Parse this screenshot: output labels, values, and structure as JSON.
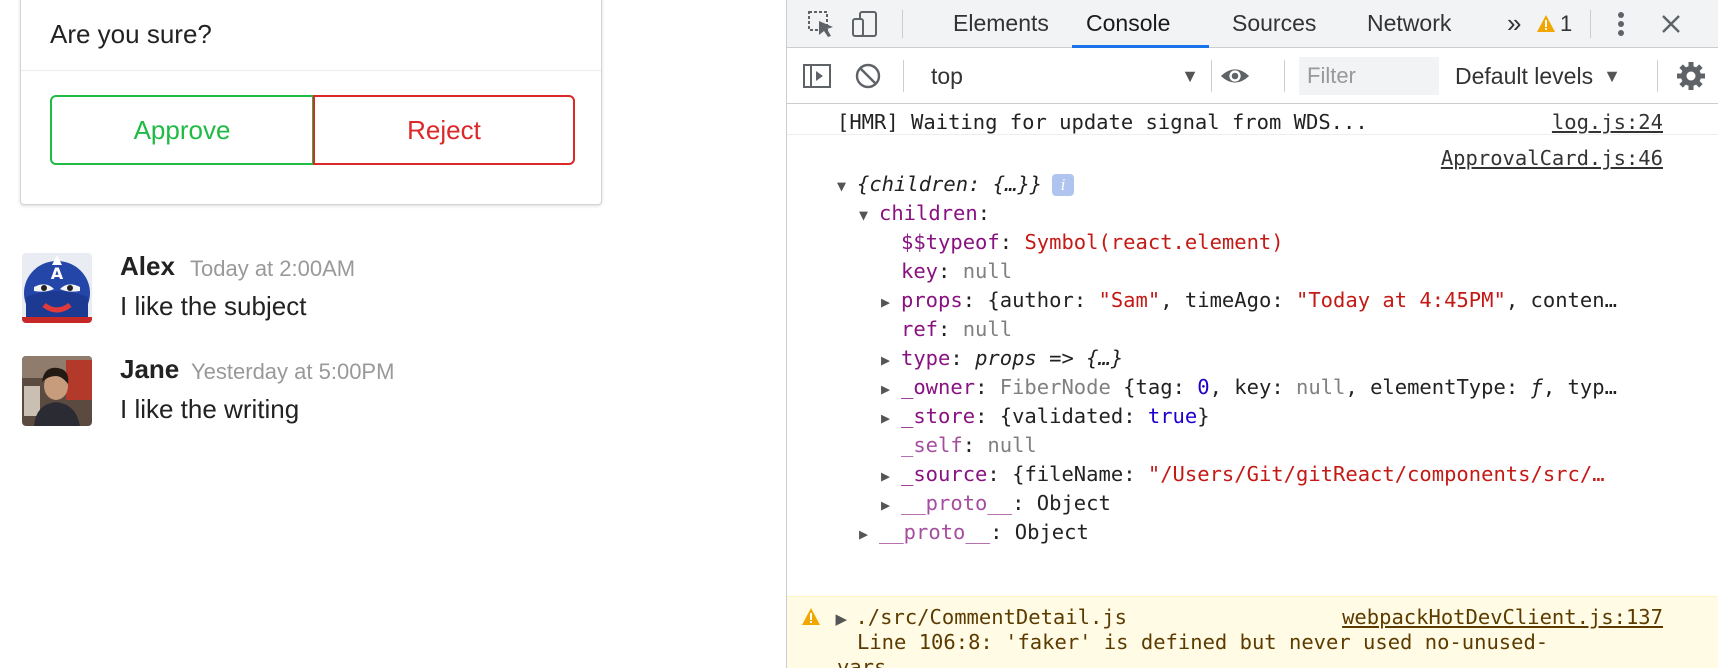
{
  "approval_card": {
    "question": "Are you sure?",
    "approve_label": "Approve",
    "reject_label": "Reject",
    "approve_color": "#21ba45",
    "reject_color": "#db2828"
  },
  "comments": [
    {
      "author": "Alex",
      "time": "Today at 2:00AM",
      "text": "I like the subject",
      "avatar": "captain-america-avatar"
    },
    {
      "author": "Jane",
      "time": "Yesterday at 5:00PM",
      "text": "I like the writing",
      "avatar": "person-photo-avatar"
    }
  ],
  "devtools": {
    "tabs": [
      "Elements",
      "Console",
      "Sources",
      "Network"
    ],
    "active_tab": "Console",
    "more_tabs_icon": "chevron-double-right-icon",
    "warning_count": "1",
    "context": "top",
    "filter_placeholder": "Filter",
    "levels_label": "Default levels",
    "accent_color": "#1a73e8"
  },
  "console": {
    "hmr": {
      "text": "[HMR] Waiting for update signal from WDS...",
      "source": "log.js:24"
    },
    "obj_source": "ApprovalCard.js:46",
    "obj_summary": "{children: {…}}",
    "children_key": "children",
    "typeof_key": "$$typeof",
    "typeof_val": "Symbol(react.element)",
    "key_key": "key",
    "null_val": "null",
    "props_key": "props",
    "props_author_key": "author",
    "props_author_val": "\"Sam\"",
    "props_time_key": "timeAgo",
    "props_time_val": "\"Today at 4:45PM\"",
    "props_tail": "conten…",
    "ref_key": "ref",
    "type_key": "type",
    "type_val": "props => {…}",
    "owner_key": "_owner",
    "owner_class": "FiberNode",
    "owner_tag_key": "tag",
    "owner_tag_val": "0",
    "owner_key_key": "key",
    "owner_et_key": "elementType",
    "owner_et_val": "ƒ",
    "owner_tail": "typ…",
    "store_key": "_store",
    "store_validated_key": "validated",
    "store_validated_val": "true",
    "self_key": "_self",
    "source_key": "_source",
    "source_fn_key": "fileName",
    "source_fn_val": "\"/Users/Git/gitReact/components/src/…",
    "proto_key": "__proto__",
    "proto_val": "Object",
    "warning": {
      "file": "./src/CommentDetail.js",
      "source": "webpackHotDevClient.js:137",
      "message": "Line 106:8:  'faker' is defined but never used  no-unused-",
      "message_wrap": "vars"
    }
  }
}
